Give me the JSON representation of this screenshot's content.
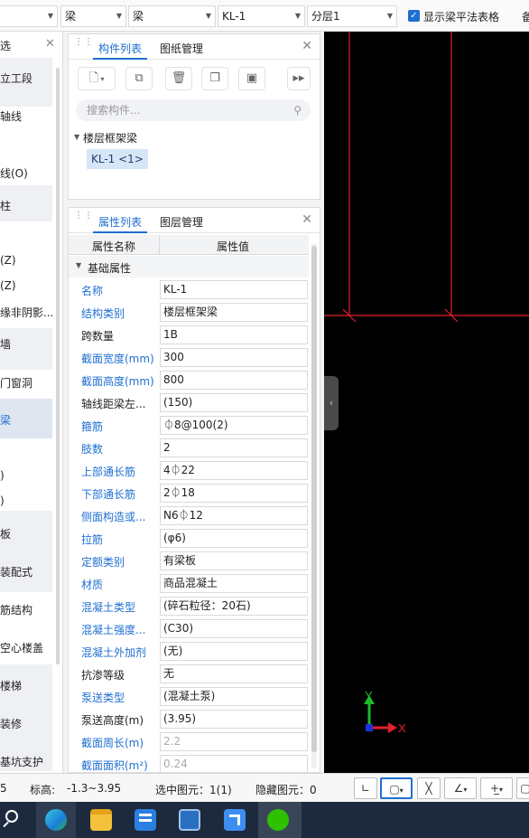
{
  "topbar": {
    "dropdowns": [
      "",
      "梁",
      "梁",
      "KL-1",
      "分层1"
    ],
    "checkbox_label": "显示梁平法表格",
    "checkbox_checked": true,
    "extra": "备"
  },
  "left_panel": {
    "header_fragment": "选",
    "items": [
      "立工段",
      "轴线",
      "线(O)",
      "柱",
      "(Z)",
      "(Z)",
      "缘非阴影...",
      "墙",
      "门窗洞",
      "梁",
      ")",
      ")",
      "板",
      "装配式",
      "筋结构",
      "空心楼盖",
      "楼梯",
      "装修",
      "基坑支护"
    ]
  },
  "component_panel": {
    "tabs": [
      "构件列表",
      "图纸管理"
    ],
    "search_placeholder": "搜索构件...",
    "tree_root": "楼层框架梁",
    "tree_item": "KL-1 <1>",
    "toolbar_icons": [
      "new-icon",
      "copy-icon",
      "delete-icon",
      "duplicate-icon",
      "save-icon",
      "expand-icon"
    ]
  },
  "property_panel": {
    "tabs": [
      "属性列表",
      "图层管理"
    ],
    "col_name": "属性名称",
    "col_value": "属性值",
    "group": "基础属性",
    "rows": [
      {
        "name": "名称",
        "value": "KL-1",
        "link": true,
        "readonly": false
      },
      {
        "name": "结构类别",
        "value": "楼层框架梁",
        "link": true,
        "readonly": false
      },
      {
        "name": "跨数量",
        "value": "1B",
        "link": false,
        "readonly": false
      },
      {
        "name": "截面宽度(mm)",
        "value": "300",
        "link": true,
        "readonly": false
      },
      {
        "name": "截面高度(mm)",
        "value": "800",
        "link": true,
        "readonly": false
      },
      {
        "name": "轴线距梁左...",
        "value": "(150)",
        "link": false,
        "readonly": false
      },
      {
        "name": "箍筋",
        "value": "⏀8@100(2)",
        "link": true,
        "readonly": false
      },
      {
        "name": "肢数",
        "value": "2",
        "link": true,
        "readonly": false
      },
      {
        "name": "上部通长筋",
        "value": "4⏀22",
        "link": true,
        "readonly": false
      },
      {
        "name": "下部通长筋",
        "value": "2⏀18",
        "link": true,
        "readonly": false
      },
      {
        "name": "侧面构造或...",
        "value": "N6⏀12",
        "link": true,
        "readonly": false
      },
      {
        "name": "拉筋",
        "value": "(φ6)",
        "link": true,
        "readonly": false
      },
      {
        "name": "定额类别",
        "value": "有梁板",
        "link": true,
        "readonly": false
      },
      {
        "name": "材质",
        "value": "商品混凝土",
        "link": true,
        "readonly": false
      },
      {
        "name": "混凝土类型",
        "value": "(碎石粒径：20石)",
        "link": true,
        "readonly": false
      },
      {
        "name": "混凝土强度...",
        "value": "(C30)",
        "link": true,
        "readonly": false
      },
      {
        "name": "混凝土外加剂",
        "value": "(无)",
        "link": true,
        "readonly": false
      },
      {
        "name": "抗渗等级",
        "value": "无",
        "link": false,
        "readonly": false
      },
      {
        "name": "泵送类型",
        "value": "(混凝土泵)",
        "link": true,
        "readonly": false
      },
      {
        "name": "泵送高度(m)",
        "value": "(3.95)",
        "link": false,
        "readonly": false
      },
      {
        "name": "截面周长(m)",
        "value": "2.2",
        "link": true,
        "readonly": true
      },
      {
        "name": "截面面积(m²)",
        "value": "0.24",
        "link": true,
        "readonly": true
      }
    ]
  },
  "canvas": {
    "axis_x": "X",
    "axis_y": "Y",
    "colors": {
      "background": "#000000",
      "lines": "#e0202a",
      "x_axis": "#e0202a",
      "y_axis": "#1dbb2c"
    }
  },
  "statusbar": {
    "frag": "5",
    "elevation_label": "标高:",
    "elevation_value": "-1.3~3.95",
    "selected": "选中图元：1(1)",
    "hidden": "隐藏图元：0"
  },
  "taskbar": {
    "icons": [
      "search-icon",
      "edge-icon",
      "explorer-icon",
      "app-icon-1",
      "app-icon-2",
      "app-icon-3",
      "wechat-icon"
    ]
  },
  "colors": {
    "accent": "#1f6fd1",
    "link_text": "#1f6fd1"
  }
}
